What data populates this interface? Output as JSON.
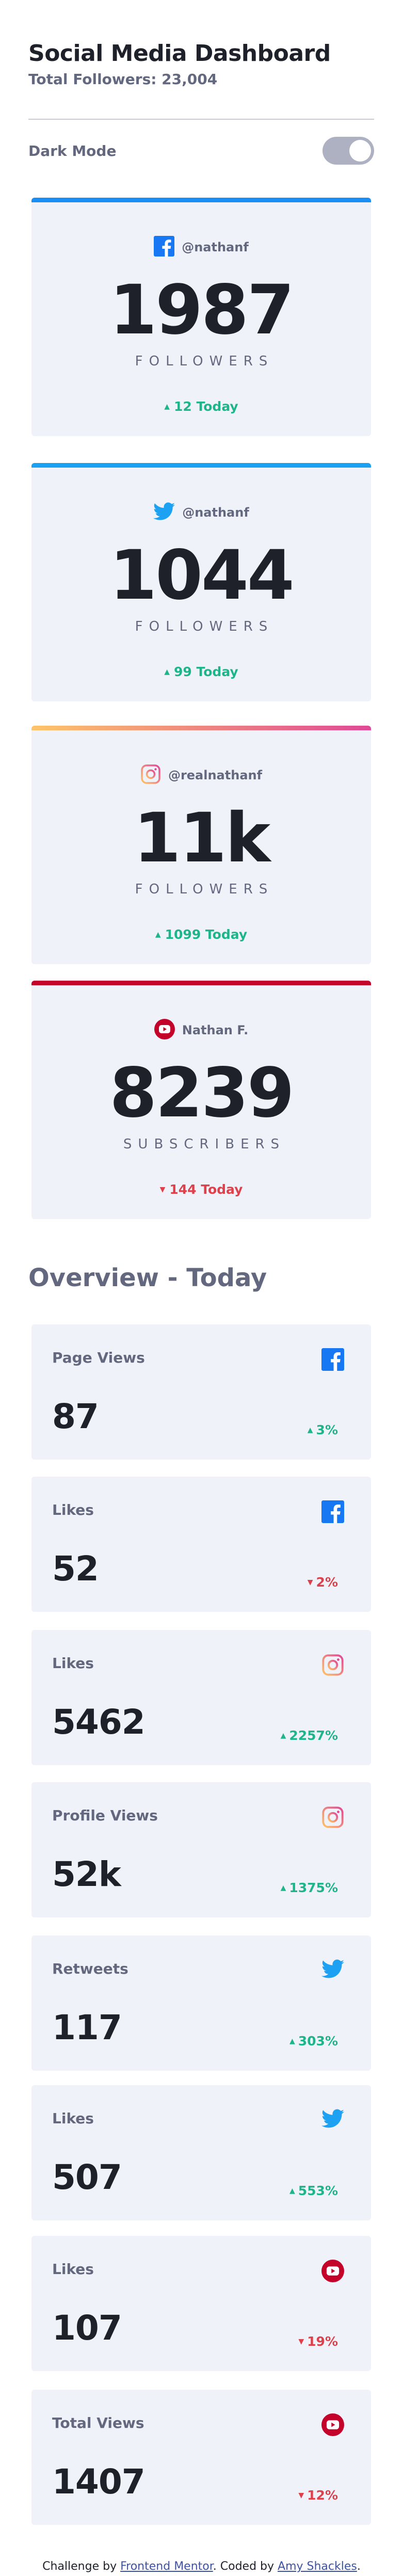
{
  "header": {
    "title": "Social Media Dashboard",
    "total_followers": "Total Followers: 23,004"
  },
  "theme_toggle": {
    "label": "Dark Mode",
    "on": true
  },
  "colors": {
    "facebook": "#198ff5",
    "twitter": "#1ca0f2",
    "instagram_start": "#fdc468",
    "instagram_end": "#df4996",
    "youtube": "#c4032a",
    "up": "#1eb589",
    "down": "#dc414c"
  },
  "follower_cards": [
    {
      "platform": "facebook",
      "icon": "facebook-icon",
      "handle": "@nathanf",
      "count": "1987",
      "unit": "FOLLOWERS",
      "today": "12 Today",
      "trend": "up"
    },
    {
      "platform": "twitter",
      "icon": "twitter-icon",
      "handle": "@nathanf",
      "count": "1044",
      "unit": "FOLLOWERS",
      "today": "99 Today",
      "trend": "up"
    },
    {
      "platform": "instagram",
      "icon": "instagram-icon",
      "handle": "@realnathanf",
      "count": "11k",
      "unit": "FOLLOWERS",
      "today": "1099 Today",
      "trend": "up"
    },
    {
      "platform": "youtube",
      "icon": "youtube-icon",
      "handle": "Nathan F.",
      "count": "8239",
      "unit": "SUBSCRIBERS",
      "today": "144 Today",
      "trend": "down"
    }
  ],
  "overview": {
    "title": "Overview - Today",
    "cards": [
      {
        "label": "Page Views",
        "icon": "facebook-icon",
        "value": "87",
        "pct": "3%",
        "trend": "up"
      },
      {
        "label": "Likes",
        "icon": "facebook-icon",
        "value": "52",
        "pct": "2%",
        "trend": "down"
      },
      {
        "label": "Likes",
        "icon": "instagram-icon",
        "value": "5462",
        "pct": "2257%",
        "trend": "up"
      },
      {
        "label": "Profile Views",
        "icon": "instagram-icon",
        "value": "52k",
        "pct": "1375%",
        "trend": "up"
      },
      {
        "label": "Retweets",
        "icon": "twitter-icon",
        "value": "117",
        "pct": "303%",
        "trend": "up"
      },
      {
        "label": "Likes",
        "icon": "twitter-icon",
        "value": "507",
        "pct": "553%",
        "trend": "up"
      },
      {
        "label": "Likes",
        "icon": "youtube-icon",
        "value": "107",
        "pct": "19%",
        "trend": "down"
      },
      {
        "label": "Total Views",
        "icon": "youtube-icon",
        "value": "1407",
        "pct": "12%",
        "trend": "down"
      }
    ]
  },
  "footer": {
    "prefix": "Challenge by",
    "link1": "Frontend Mentor",
    "middle": ". Coded by",
    "link2": "Amy Shackles",
    "suffix": "."
  }
}
